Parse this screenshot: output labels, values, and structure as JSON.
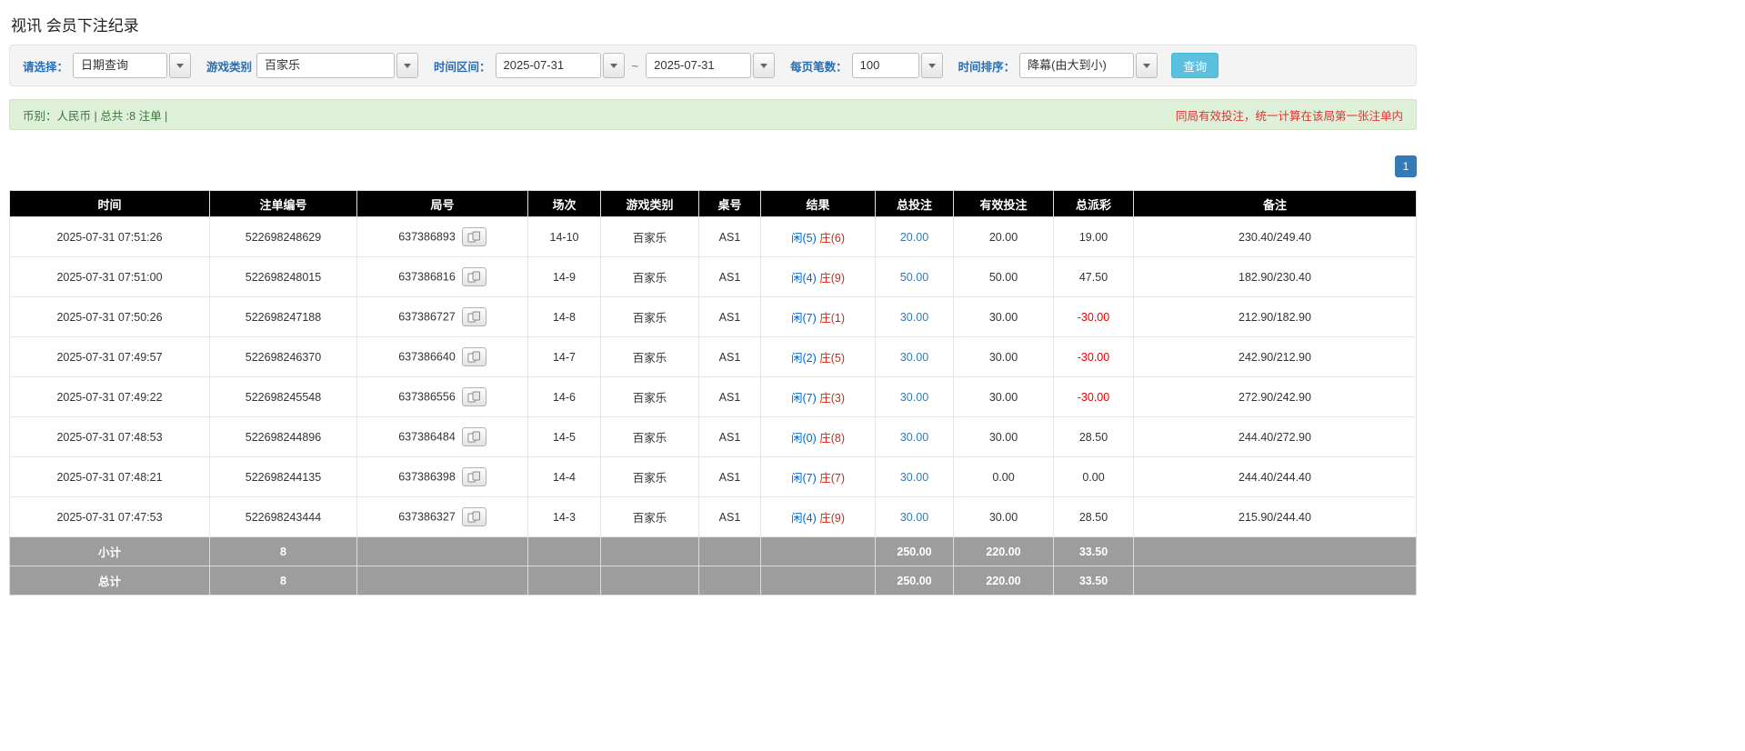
{
  "page_title": "视讯 会员下注纪录",
  "filter_bar": {
    "select_label": "请选择：",
    "select_value": "日期查询",
    "game_type_label": "游戏类别",
    "game_type_value": "百家乐",
    "date_range_label": "时间区间：",
    "date_from": "2025-07-31",
    "date_separator": "~",
    "date_to": "2025-07-31",
    "page_size_label": "每页笔数：",
    "page_size_value": "100",
    "time_sort_label": "时间排序：",
    "time_sort_value": "降幕(由大到小)",
    "search_button_label": "查询"
  },
  "summary_bar": {
    "left_text": "币别：人民币 | 总共 :8 注单 |",
    "right_text": "同局有效投注，统一计算在该局第一张注单内"
  },
  "pagination": {
    "page": "1"
  },
  "table": {
    "headers": [
      "时间",
      "注单编号",
      "局号",
      "场次",
      "游戏类别",
      "桌号",
      "结果",
      "总投注",
      "有效投注",
      "总派彩",
      "备注"
    ],
    "rows": [
      {
        "time": "2025-07-31 07:51:26",
        "bet_id": "522698248629",
        "round_id": "637386893",
        "session": "14-10",
        "game_type": "百家乐",
        "table_no": "AS1",
        "result_player": "闲(5)",
        "result_banker": "庄(6)",
        "total_bet": "20.00",
        "valid_bet": "20.00",
        "payout": "19.00",
        "note": "230.40/249.40"
      },
      {
        "time": "2025-07-31 07:51:00",
        "bet_id": "522698248015",
        "round_id": "637386816",
        "session": "14-9",
        "game_type": "百家乐",
        "table_no": "AS1",
        "result_player": "闲(4)",
        "result_banker": "庄(9)",
        "total_bet": "50.00",
        "valid_bet": "50.00",
        "payout": "47.50",
        "note": "182.90/230.40"
      },
      {
        "time": "2025-07-31 07:50:26",
        "bet_id": "522698247188",
        "round_id": "637386727",
        "session": "14-8",
        "game_type": "百家乐",
        "table_no": "AS1",
        "result_player": "闲(7)",
        "result_banker": "庄(1)",
        "total_bet": "30.00",
        "valid_bet": "30.00",
        "payout": "-30.00",
        "note": "212.90/182.90"
      },
      {
        "time": "2025-07-31 07:49:57",
        "bet_id": "522698246370",
        "round_id": "637386640",
        "session": "14-7",
        "game_type": "百家乐",
        "table_no": "AS1",
        "result_player": "闲(2)",
        "result_banker": "庄(5)",
        "total_bet": "30.00",
        "valid_bet": "30.00",
        "payout": "-30.00",
        "note": "242.90/212.90"
      },
      {
        "time": "2025-07-31 07:49:22",
        "bet_id": "522698245548",
        "round_id": "637386556",
        "session": "14-6",
        "game_type": "百家乐",
        "table_no": "AS1",
        "result_player": "闲(7)",
        "result_banker": "庄(3)",
        "total_bet": "30.00",
        "valid_bet": "30.00",
        "payout": "-30.00",
        "note": "272.90/242.90"
      },
      {
        "time": "2025-07-31 07:48:53",
        "bet_id": "522698244896",
        "round_id": "637386484",
        "session": "14-5",
        "game_type": "百家乐",
        "table_no": "AS1",
        "result_player": "闲(0)",
        "result_banker": "庄(8)",
        "total_bet": "30.00",
        "valid_bet": "30.00",
        "payout": "28.50",
        "note": "244.40/272.90"
      },
      {
        "time": "2025-07-31 07:48:21",
        "bet_id": "522698244135",
        "round_id": "637386398",
        "session": "14-4",
        "game_type": "百家乐",
        "table_no": "AS1",
        "result_player": "闲(7)",
        "result_banker": "庄(7)",
        "total_bet": "30.00",
        "valid_bet": "0.00",
        "payout": "0.00",
        "note": "244.40/244.40"
      },
      {
        "time": "2025-07-31 07:47:53",
        "bet_id": "522698243444",
        "round_id": "637386327",
        "session": "14-3",
        "game_type": "百家乐",
        "table_no": "AS1",
        "result_player": "闲(4)",
        "result_banker": "庄(9)",
        "total_bet": "30.00",
        "valid_bet": "30.00",
        "payout": "28.50",
        "note": "215.90/244.40"
      }
    ],
    "subtotal_row": {
      "label": "小计",
      "count": "8",
      "total_bet": "250.00",
      "valid_bet": "220.00",
      "payout": "33.50"
    },
    "total_row": {
      "label": "总计",
      "count": "8",
      "total_bet": "250.00",
      "valid_bet": "220.00",
      "payout": "33.50"
    }
  },
  "icons": {
    "combo_arrow": "caret-down-icon",
    "round_cell": "cards-icon"
  },
  "colors": {
    "accent_blue": "#337ab7",
    "filter_label_blue": "#2a6db0",
    "result_player_blue": "#0066cc",
    "result_banker_red": "#d9230f",
    "negative_red": "#e60000",
    "notice_red": "#e03131",
    "summary_text_green": "#3c763d",
    "summary_bg": "#dff0d8",
    "summary_border": "#d2e6c5",
    "search_button_bg": "#5bc0de",
    "search_button_border": "#46b8da",
    "header_bg": "#000000",
    "footer_bg": "#9d9d9d"
  }
}
